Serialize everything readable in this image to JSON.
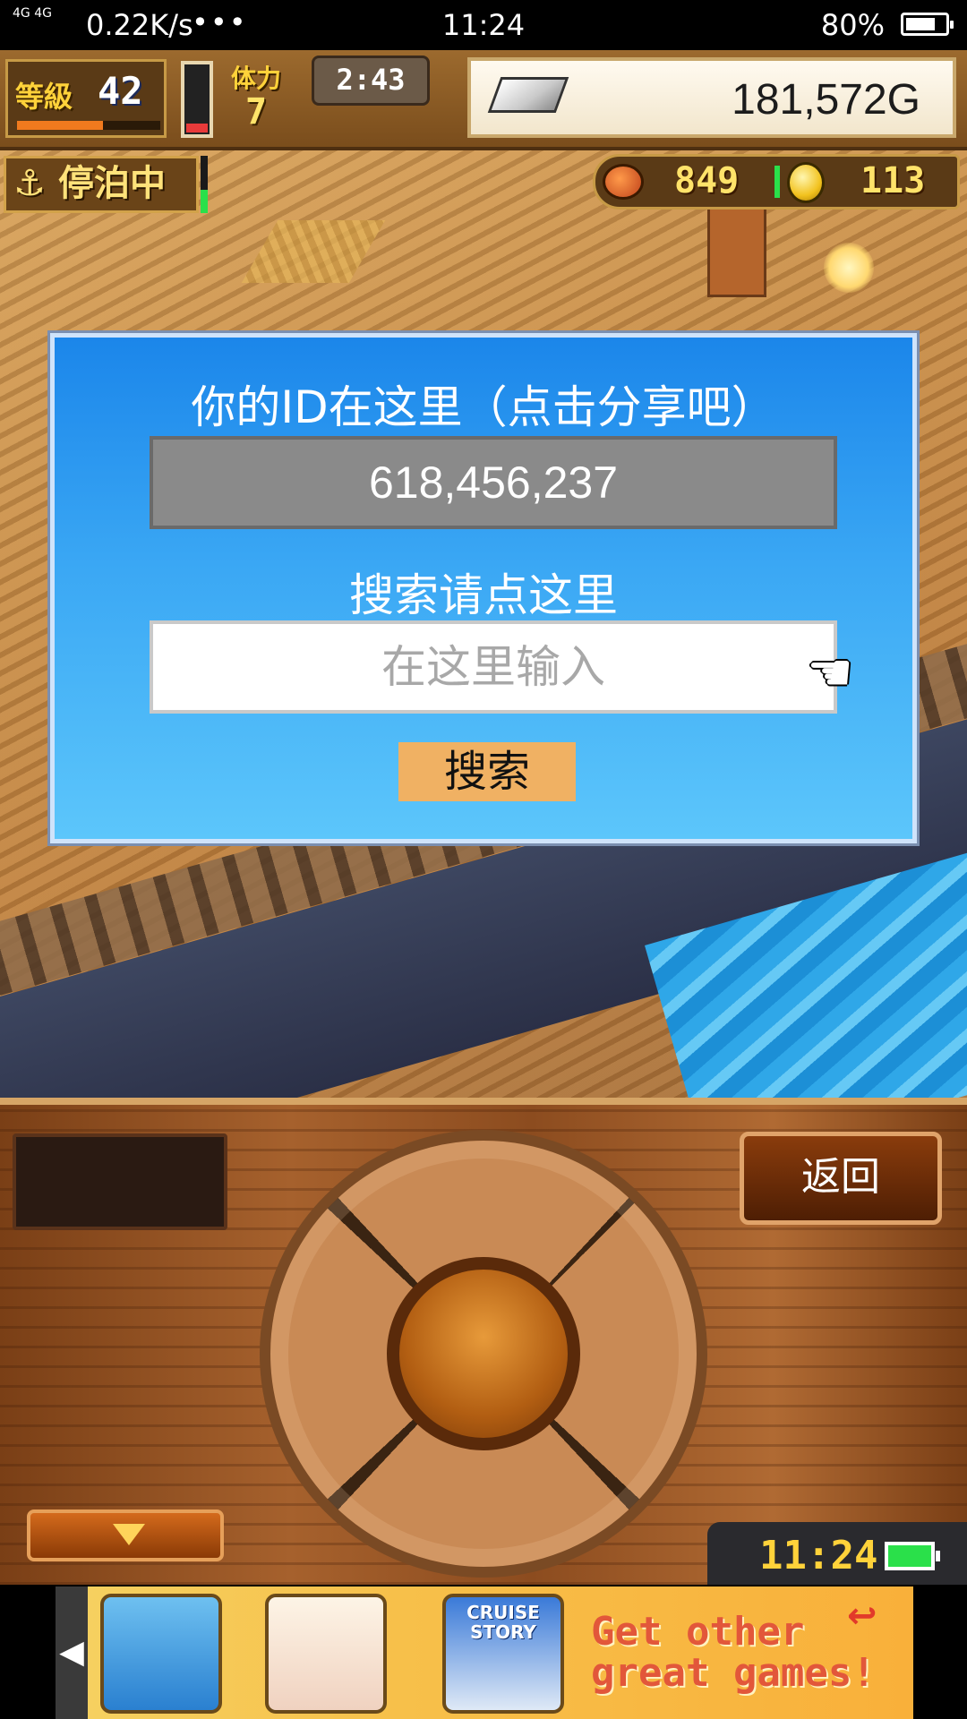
{
  "status_bar": {
    "network": "4G 4G",
    "speed": "0.22K/s",
    "more": "•••",
    "time": "11:24",
    "battery_pct": "80%",
    "battery_level": 0.8
  },
  "hud": {
    "level_label": "等級",
    "level_value": "42",
    "level_progress": 0.6,
    "stamina_label": "体力",
    "stamina_value": "7",
    "stamina_gauge_level": 0.18,
    "timer": "2:43",
    "money": "181,572G",
    "status_label": "停泊中",
    "food_value": "849",
    "coin_value": "113"
  },
  "dialog": {
    "title": "你的ID在这里（点击分享吧）",
    "player_id": "618,456,237",
    "search_title": "搜索请点这里",
    "search_placeholder": "在这里输入",
    "search_button": "搜索"
  },
  "controls": {
    "back_button": "返回",
    "clock": "11:24"
  },
  "ad": {
    "left_arrow": "◀",
    "tile_caption": "CRUISE STORY",
    "copy_line1": "Get other",
    "copy_line2": "great games!",
    "return_icon": "↩"
  },
  "icons": {
    "anchor": "⚓",
    "pointer": "☚"
  }
}
